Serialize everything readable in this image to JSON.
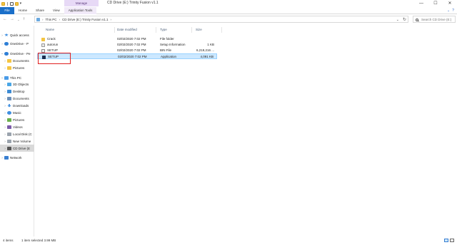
{
  "window": {
    "title": "CD Drive (E:) Trinity Fusion v1.1",
    "contextual_tab": "Manage",
    "controls": [
      "—",
      "☐",
      "✕"
    ]
  },
  "ribbon": {
    "tabs": [
      "File",
      "Home",
      "Share",
      "View",
      "Application Tools"
    ]
  },
  "address": {
    "breadcrumb": [
      "This PC",
      "CD Drive (E:) Trinity Fusion v1.1"
    ],
    "search_placeholder": "Search CD Drive (E:)"
  },
  "nav": {
    "items": [
      {
        "label": "Quick access",
        "icon": "star-icon"
      },
      {
        "label": "OneDrive - P",
        "icon": "cloud-icon"
      },
      {
        "label": "OneDrive - Pe",
        "icon": "cloud-icon"
      },
      {
        "label": "Documents",
        "icon": "folder-icon"
      },
      {
        "label": "Pictures",
        "icon": "folder-icon"
      },
      {
        "label": "This PC",
        "icon": "computer-icon"
      },
      {
        "label": "3D Objects",
        "icon": "cube-icon"
      },
      {
        "label": "Desktop",
        "icon": "desktop-icon"
      },
      {
        "label": "Documents",
        "icon": "documents-icon"
      },
      {
        "label": "Downloads",
        "icon": "download-icon"
      },
      {
        "label": "Music",
        "icon": "music-icon"
      },
      {
        "label": "Pictures",
        "icon": "pictures-icon"
      },
      {
        "label": "Videos",
        "icon": "videos-icon"
      },
      {
        "label": "Local Disk (C",
        "icon": "disk-icon"
      },
      {
        "label": "New Volume",
        "icon": "disk-icon"
      },
      {
        "label": "CD Drive (E",
        "icon": "cd-icon"
      },
      {
        "label": "Network",
        "icon": "network-icon"
      }
    ]
  },
  "columns": {
    "name": "Name",
    "date": "Date modified",
    "type": "Type",
    "size": "Size"
  },
  "files": [
    {
      "name": "Crack",
      "date": "02/02/2020 7:02 PM",
      "type": "File folder",
      "size": "",
      "icon": "folder-icon"
    },
    {
      "name": "autorun",
      "date": "02/02/2020 7:02 PM",
      "type": "Setup Information",
      "size": "1 KB",
      "icon": "settings-file-icon"
    },
    {
      "name": "SETUP",
      "date": "02/02/2020 7:02 PM",
      "type": "BIN File",
      "size": "6,219,216 ...",
      "icon": "bin-file-icon"
    },
    {
      "name": "SETUP",
      "date": "02/02/2020 7:02 PM",
      "type": "Application",
      "size": "4,091 KB",
      "icon": "application-icon"
    }
  ],
  "status": {
    "count": "4 items",
    "selected": "1 item selected  3.99 MB"
  },
  "colors": {
    "file_tab": "#1a6fc9",
    "selection": "#cce8ff",
    "annotation": "#e02020"
  }
}
